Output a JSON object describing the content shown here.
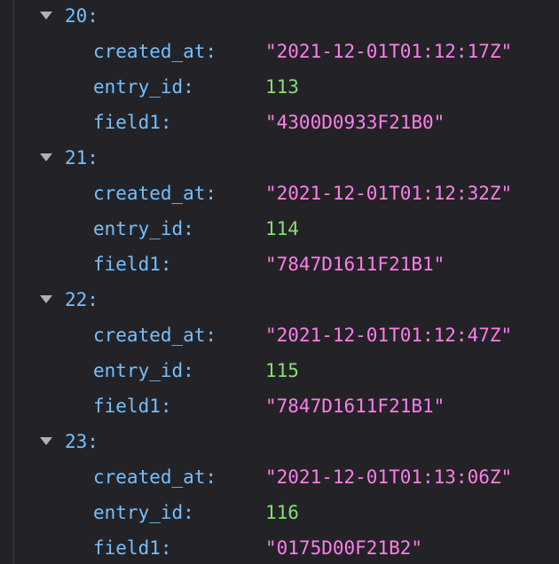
{
  "colors": {
    "background": "#232327",
    "key": "#75bfff",
    "string": "#ff7de9",
    "number": "#86de74",
    "twisty": "#b1b1b3"
  },
  "icons": {
    "toggle": "triangle-down-icon"
  },
  "entries": [
    {
      "index": "20:",
      "fields": [
        {
          "key": "created_at:",
          "value": "\"2021-12-01T01:12:17Z\"",
          "type": "string"
        },
        {
          "key": "entry_id:",
          "value": "113",
          "type": "number"
        },
        {
          "key": "field1:",
          "value": "\"4300D0933F21B0\"",
          "type": "string"
        }
      ]
    },
    {
      "index": "21:",
      "fields": [
        {
          "key": "created_at:",
          "value": "\"2021-12-01T01:12:32Z\"",
          "type": "string"
        },
        {
          "key": "entry_id:",
          "value": "114",
          "type": "number"
        },
        {
          "key": "field1:",
          "value": "\"7847D1611F21B1\"",
          "type": "string"
        }
      ]
    },
    {
      "index": "22:",
      "fields": [
        {
          "key": "created_at:",
          "value": "\"2021-12-01T01:12:47Z\"",
          "type": "string"
        },
        {
          "key": "entry_id:",
          "value": "115",
          "type": "number"
        },
        {
          "key": "field1:",
          "value": "\"7847D1611F21B1\"",
          "type": "string"
        }
      ]
    },
    {
      "index": "23:",
      "fields": [
        {
          "key": "created_at:",
          "value": "\"2021-12-01T01:13:06Z\"",
          "type": "string"
        },
        {
          "key": "entry_id:",
          "value": "116",
          "type": "number"
        },
        {
          "key": "field1:",
          "value": "\"0175D00F21B2\"",
          "type": "string"
        }
      ]
    }
  ]
}
